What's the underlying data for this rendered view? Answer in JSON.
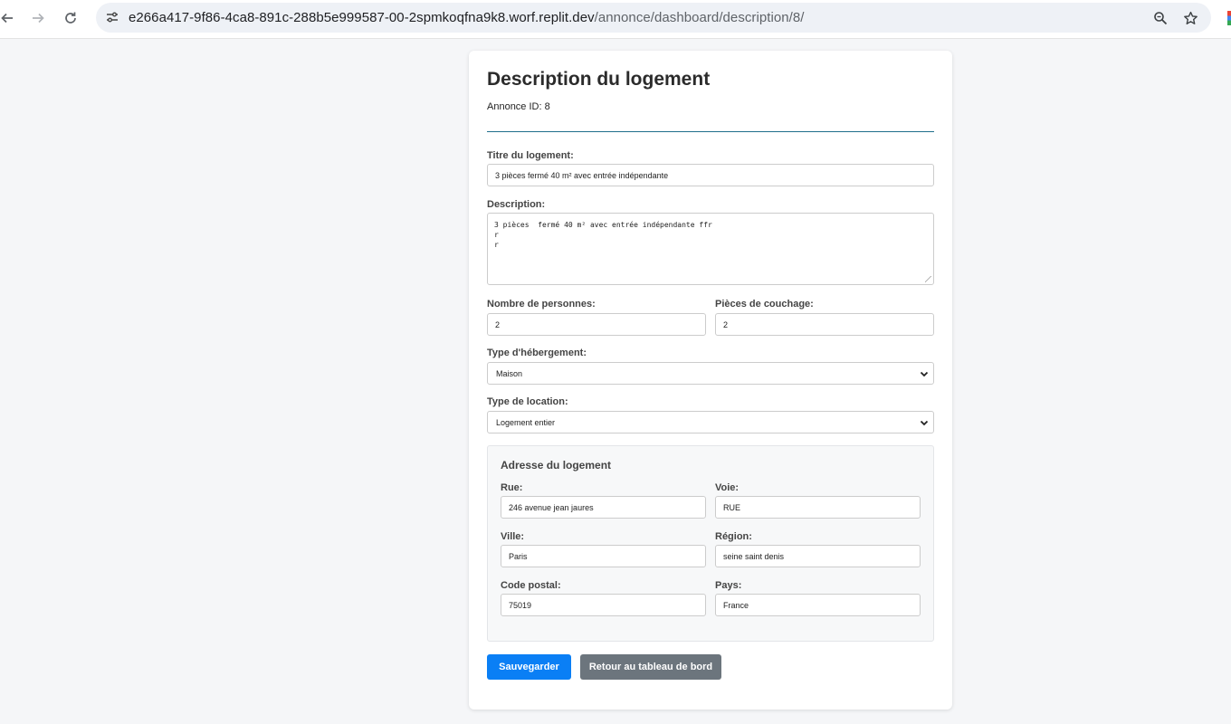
{
  "browser": {
    "url_host": "e266a417-9f86-4ca8-891c-288b5e999587-00-2spmkoqfna9k8.worf.replit.dev",
    "url_path": "/annonce/dashboard/description/8/"
  },
  "page": {
    "title": "Description du logement",
    "annonce_id": "Annonce ID: 8"
  },
  "form": {
    "titre_label": "Titre du logement:",
    "titre_value": "3 pièces  fermé 40 m² avec entrée indépendante",
    "description_label": "Description:",
    "description_value": "3 pièces  fermé 40 m² avec entrée indépendante ffr\nr\nr",
    "personnes_label": "Nombre de personnes:",
    "personnes_value": "2",
    "couchage_label": "Pièces de couchage:",
    "couchage_value": "2",
    "hebergement_label": "Type d'hébergement:",
    "hebergement_value": "Maison",
    "location_label": "Type de location:",
    "location_value": "Logement entier"
  },
  "address": {
    "title": "Adresse du logement",
    "rue_label": "Rue:",
    "rue_value": "246 avenue jean jaures",
    "voie_label": "Voie:",
    "voie_value": "RUE",
    "ville_label": "Ville:",
    "ville_value": "Paris",
    "region_label": "Région:",
    "region_value": "seine saint denis",
    "code_label": "Code postal:",
    "code_value": "75019",
    "pays_label": "Pays:",
    "pays_value": "France"
  },
  "actions": {
    "save_label": "Sauvegarder",
    "back_label": "Retour au tableau de bord"
  },
  "colors": {
    "primary": "#0a7ff5",
    "secondary": "#6c757d",
    "divider": "#1f6f8b"
  },
  "icons": {
    "back": "arrow-left-icon",
    "forward": "arrow-right-icon",
    "reload": "reload-icon",
    "site_info": "tune-icon",
    "zoom": "zoom-icon",
    "bookmark": "star-icon"
  }
}
